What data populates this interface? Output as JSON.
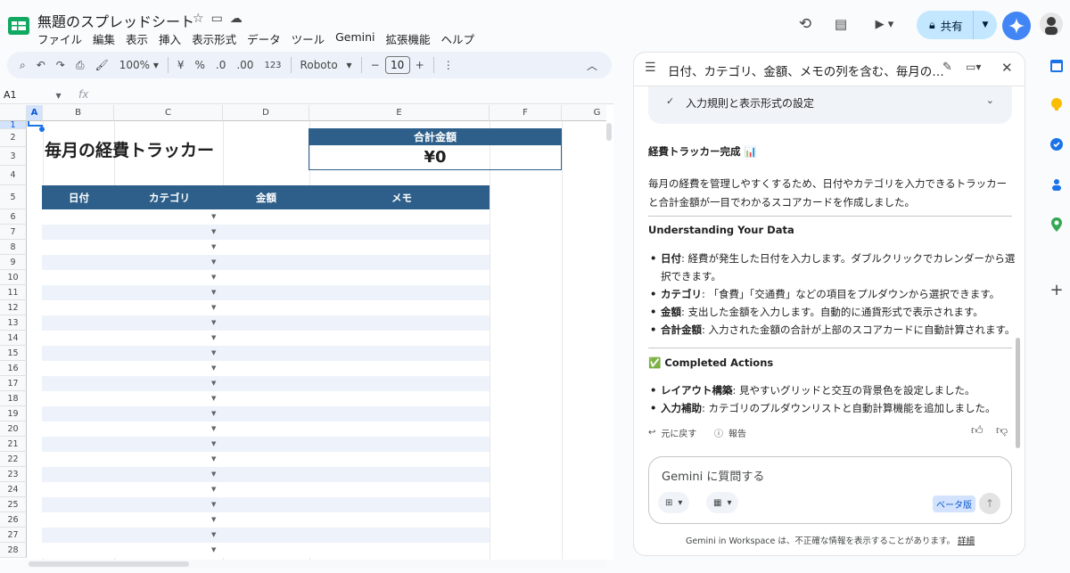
{
  "header": {
    "title": "無題のスプレッドシート",
    "menus": [
      "ファイル",
      "編集",
      "表示",
      "挿入",
      "表示形式",
      "データ",
      "ツール",
      "Gemini",
      "拡張機能",
      "ヘルプ"
    ],
    "share_label": "共有"
  },
  "toolbar": {
    "zoom": "100%",
    "currency": "¥",
    "percent": "%",
    "dec_decrease": ".0",
    "dec_increase": ".00",
    "number_format": "123",
    "font": "Roboto",
    "font_size": "10"
  },
  "formula_bar": {
    "cell_ref": "A1",
    "fx": "fx"
  },
  "columns": [
    "A",
    "B",
    "C",
    "D",
    "E",
    "F",
    "G"
  ],
  "rows": [
    "1",
    "2",
    "3",
    "4",
    "5",
    "6",
    "7",
    "8",
    "9",
    "10",
    "11",
    "12",
    "13",
    "14",
    "15",
    "16",
    "17",
    "18",
    "19",
    "20",
    "21",
    "22",
    "23",
    "24",
    "25",
    "26",
    "27",
    "28"
  ],
  "sheet": {
    "title": "毎月の経費トラッカー",
    "scorecard_label": "合計金額",
    "scorecard_value": "¥0",
    "table_headers": [
      "日付",
      "カテゴリ",
      "金額",
      "メモ"
    ]
  },
  "panel": {
    "title": "日付、カテゴリ、金額、メモの列を含む、毎月の…",
    "collapsed_step": "入力規則と表示形式の設定",
    "heading1": "経費トラッカー完成 📊",
    "intro": "毎月の経費を管理しやすくするため、日付やカテゴリを入力できるトラッカーと合計金額が一目でわかるスコアカードを作成しました。",
    "heading2": "Understanding Your Data",
    "data_items": [
      {
        "term": "日付",
        "text": ": 経費が発生した日付を入力します。ダブルクリックでカレンダーから選択できます。"
      },
      {
        "term": "カテゴリ",
        "text": ": 「食費」「交通費」などの項目をプルダウンから選択できます。"
      },
      {
        "term": "金額",
        "text": ": 支出した金額を入力します。自動的に通貨形式で表示されます。"
      },
      {
        "term": "合計金額",
        "text": ": 入力された金額の合計が上部のスコアカードに自動計算されます。"
      }
    ],
    "heading3": "✅ Completed Actions",
    "action_items": [
      {
        "term": "レイアウト構築",
        "text": ": 見やすいグリッドと交互の背景色を設定しました。"
      },
      {
        "term": "入力補助",
        "text": ": カテゴリのプルダウンリストと自動計算機能を追加しました。"
      }
    ],
    "undo_label": "元に戻す",
    "report_label": "報告",
    "input_placeholder": "Gemini に質問する",
    "beta_label": "ベータ版",
    "disclaimer": "Gemini in Workspace は、不正確な情報を表示することがあります。",
    "disclaimer_link": "詳細"
  },
  "colors": {
    "accent": "#2d5f8a",
    "alt_row": "#eef3fb",
    "select": "#1a73e8"
  }
}
